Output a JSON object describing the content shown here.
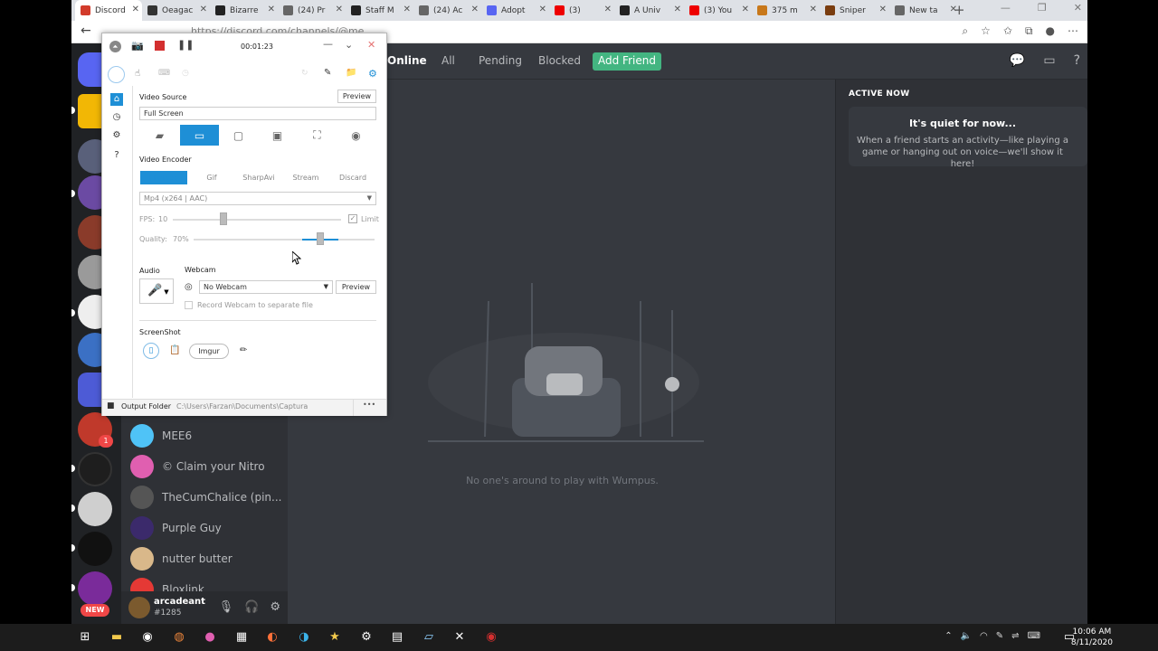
{
  "browser": {
    "tabs": [
      {
        "label": "Discord",
        "color": "#d23b2b",
        "active": true
      },
      {
        "label": "Oeagac",
        "color": "#333"
      },
      {
        "label": "Bizarre",
        "color": "#222"
      },
      {
        "label": "(24) Pr",
        "color": "#666"
      },
      {
        "label": "Staff M",
        "color": "#222"
      },
      {
        "label": "(24) Ac",
        "color": "#666"
      },
      {
        "label": "Adopt",
        "color": "#5865f2"
      },
      {
        "label": "(3)",
        "color": "#e00"
      },
      {
        "label": "A Univ",
        "color": "#222"
      },
      {
        "label": "(3) You",
        "color": "#e00"
      },
      {
        "label": "375 m",
        "color": "#c8781a"
      },
      {
        "label": "Sniper",
        "color": "#7a3d10"
      },
      {
        "label": "New ta",
        "color": "#666"
      }
    ],
    "url": "https://discord.com/channels/@me"
  },
  "discord": {
    "tabs": {
      "online": "Online",
      "all": "All",
      "pending": "Pending",
      "blocked": "Blocked",
      "add_friend": "Add Friend"
    },
    "active_now": {
      "header": "ACTIVE NOW",
      "title": "It's quiet for now...",
      "body": "When a friend starts an activity—like playing a game or hanging out on voice—we'll show it here!"
    },
    "empty_message": "No one's around to play with Wumpus.",
    "dms": [
      {
        "name": "MEE6",
        "color": "#4fc3f7"
      },
      {
        "name": "© Claim your Nitro",
        "color": "#e05fb0"
      },
      {
        "name": "TheCumChalice (pin...",
        "color": "#555"
      },
      {
        "name": "Purple Guy",
        "color": "#3b2a6b"
      },
      {
        "name": "nutter butter",
        "color": "#d9b88a"
      },
      {
        "name": "Bloxlink",
        "color": "#e53935"
      }
    ],
    "user": {
      "name": "arcadeant",
      "tag": "#1285"
    },
    "guild_badge": "1",
    "new_badge": "NEW"
  },
  "captura": {
    "timer": "00:01:23",
    "video_source_label": "Video Source",
    "preview_label": "Preview",
    "source_value": "Full Screen",
    "video_encoder_label": "Video Encoder",
    "encoders": [
      "FFmpeg",
      "Gif",
      "SharpAvi",
      "Stream",
      "Discard"
    ],
    "encoder_format": "Mp4 (x264 | AAC)",
    "fps_label": "FPS:",
    "fps_value": "10",
    "fps_fraction": 0.3,
    "limit_label": "Limit",
    "quality_label": "Quality:",
    "quality_value": "70%",
    "quality_fraction": 0.7,
    "audio_label": "Audio",
    "webcam_label": "Webcam",
    "webcam_value": "No Webcam",
    "webcam_preview": "Preview",
    "record_webcam_label": "Record Webcam to separate file",
    "screenshot_label": "ScreenShot",
    "imgur_label": "Imgur",
    "output_folder_label": "Output Folder",
    "output_folder_path": "C:\\Users\\Farzan\\Documents\\Captura",
    "more": "•••"
  },
  "taskbar": {
    "time": "10:06 AM",
    "date": "8/11/2020"
  }
}
